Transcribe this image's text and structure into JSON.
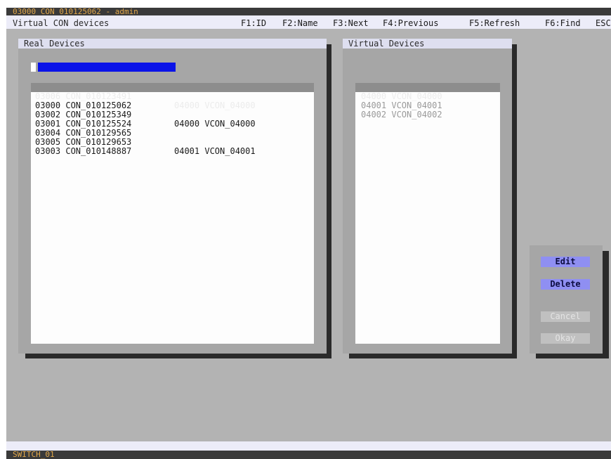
{
  "window": {
    "title": "03000 CON_010125062 - admin",
    "subtitle": "Virtual CON devices"
  },
  "function_keys": [
    {
      "label": "F1:ID"
    },
    {
      "label": "F2:Name"
    },
    {
      "label": "F3:Next"
    },
    {
      "label": "F4:Previous"
    },
    {
      "label": "F5:Refresh"
    },
    {
      "label": "F6:Find"
    },
    {
      "label": "ESC"
    }
  ],
  "real_devices": {
    "title": "Real Devices",
    "filter_value": "",
    "rows": [
      {
        "id_name": "03006 CON_010123491",
        "assigned": "04000 VCON_04000",
        "selected": true
      },
      {
        "id_name": "03000 CON_010125062",
        "assigned": ""
      },
      {
        "id_name": "03002 CON_010125349",
        "assigned": "04000 VCON_04000"
      },
      {
        "id_name": "03001 CON_010125524",
        "assigned": ""
      },
      {
        "id_name": "03004 CON_010129565",
        "assigned": ""
      },
      {
        "id_name": "03005 CON_010129653",
        "assigned": "04001 VCON_04001"
      },
      {
        "id_name": "03003 CON_010148887",
        "assigned": ""
      }
    ]
  },
  "virtual_devices": {
    "title": "Virtual Devices",
    "rows": [
      {
        "label": "04000 VCON_04000",
        "selected": true
      },
      {
        "label": "04001 VCON_04001"
      },
      {
        "label": "04002 VCON_04002"
      }
    ]
  },
  "actions": {
    "edit": "Edit",
    "delete": "Delete",
    "cancel": "Cancel",
    "okay": "Okay"
  },
  "status": {
    "switch_name": "SWITCH_01"
  },
  "colors": {
    "screen_bg": "#b3b3b3",
    "title_bar": "#3a3a3a",
    "title_text": "#e2a84a",
    "header_bar": "#ececf8",
    "filter_bar": "#0a13e8",
    "button_active": "#8f8ff2"
  }
}
